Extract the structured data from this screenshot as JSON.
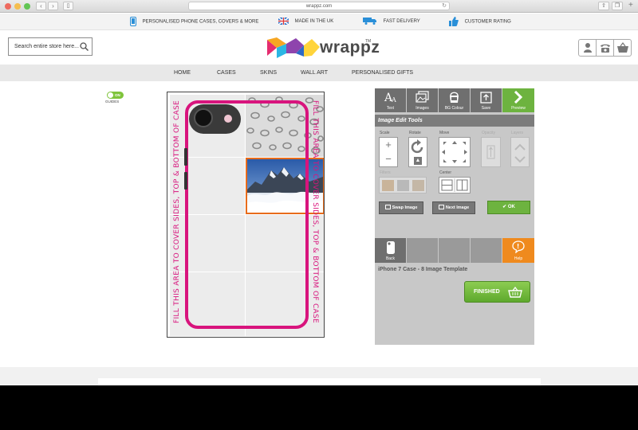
{
  "browser": {
    "url": "wrappz.com",
    "traffic_lights": [
      "#ee6a5f",
      "#f5be4f",
      "#62c554"
    ]
  },
  "usp": {
    "items": [
      {
        "icon": "phone-icon",
        "label": "PERSONALISED PHONE CASES, COVERS & MORE"
      },
      {
        "icon": "uk-flag-icon",
        "label": "MADE IN THE UK"
      },
      {
        "icon": "delivery-truck-icon",
        "label": "FAST DELIVERY"
      },
      {
        "icon": "thumbs-up-icon",
        "label": "CUSTOMER RATING"
      }
    ],
    "icon_color": "#2a8fd8"
  },
  "header": {
    "search_placeholder": "Search entire store here...",
    "logo_text": "wrappz",
    "logo_tm": "TM",
    "icons": [
      "account-icon",
      "phone-contact-icon",
      "basket-icon"
    ]
  },
  "nav": {
    "items": [
      "HOME",
      "CASES",
      "SKINS",
      "WALL ART",
      "PERSONALISED GIFTS"
    ]
  },
  "guides": {
    "toggle_label": "ON",
    "label": "GUIDES"
  },
  "canvas": {
    "fill_text": "FILL THIS AREA TO COVER SIDES, TOP & BOTTOM OF CASE",
    "accent": "#d8147d",
    "selection_color": "#e86c1b"
  },
  "toolbar": {
    "buttons": [
      {
        "icon": "text-icon",
        "label": "Text"
      },
      {
        "icon": "images-icon",
        "label": "Images"
      },
      {
        "icon": "bg-colour-icon",
        "label": "BG Colour"
      },
      {
        "icon": "save-icon",
        "label": "Save"
      },
      {
        "icon": "preview-arrow-icon",
        "label": "Preview"
      }
    ]
  },
  "image_tools": {
    "title": "Image Edit Tools",
    "scale_label": "Scale",
    "rotate_label": "Rotate",
    "move_label": "Move",
    "opacity_label": "Opacity",
    "layers_label": "Layers",
    "filters_label": "Filters",
    "center_label": "Center",
    "swap_label": "Swap Image",
    "next_label": "Next Image",
    "ok_label": "OK"
  },
  "bottom_toolbar": {
    "back_label": "Back",
    "help_label": "Help"
  },
  "template_title": "iPhone 7 Case - 8 Image Template",
  "finished_label": "FINISHED",
  "colors": {
    "green": "#6db33f",
    "orange": "#ef8a1e",
    "panel_bg": "#c8c8c8"
  }
}
